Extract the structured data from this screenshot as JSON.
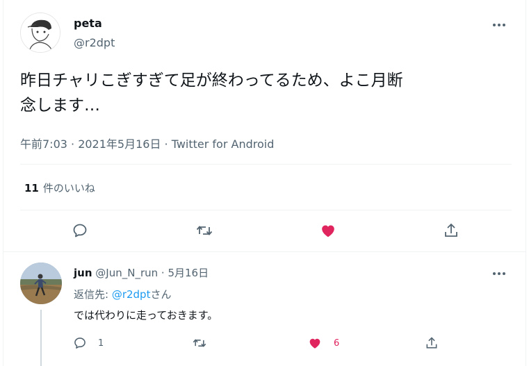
{
  "tweet": {
    "author_name": "peta",
    "author_handle": "@r2dpt",
    "text_line1": "昨日チャリこぎすぎて足が終わってるため、よこ月断",
    "text_line2": "念します…",
    "meta": "午前7:03 · 2021年5月16日 · Twitter for Android",
    "likes_count": "11",
    "likes_label": "件のいいね",
    "avatar_icon": "user-avatar-sketch",
    "liked": true
  },
  "reply": {
    "author_name": "jun",
    "author_handle": "@Jun_N_run",
    "separator": " · ",
    "date": "5月16日",
    "replying_prefix": "返信先: ",
    "replying_mention": "@r2dpt",
    "replying_suffix": "さん",
    "text": "では代わりに走っておきます。",
    "reply_count": "1",
    "like_count": "6",
    "liked": true
  },
  "colors": {
    "text": "#0f1419",
    "muted": "#536471",
    "accent": "#1d9bf0",
    "like": "#e0245e",
    "divider": "#eff3f4"
  },
  "icons": [
    "more-icon",
    "reply-icon",
    "retweet-icon",
    "heart-icon",
    "share-icon"
  ]
}
